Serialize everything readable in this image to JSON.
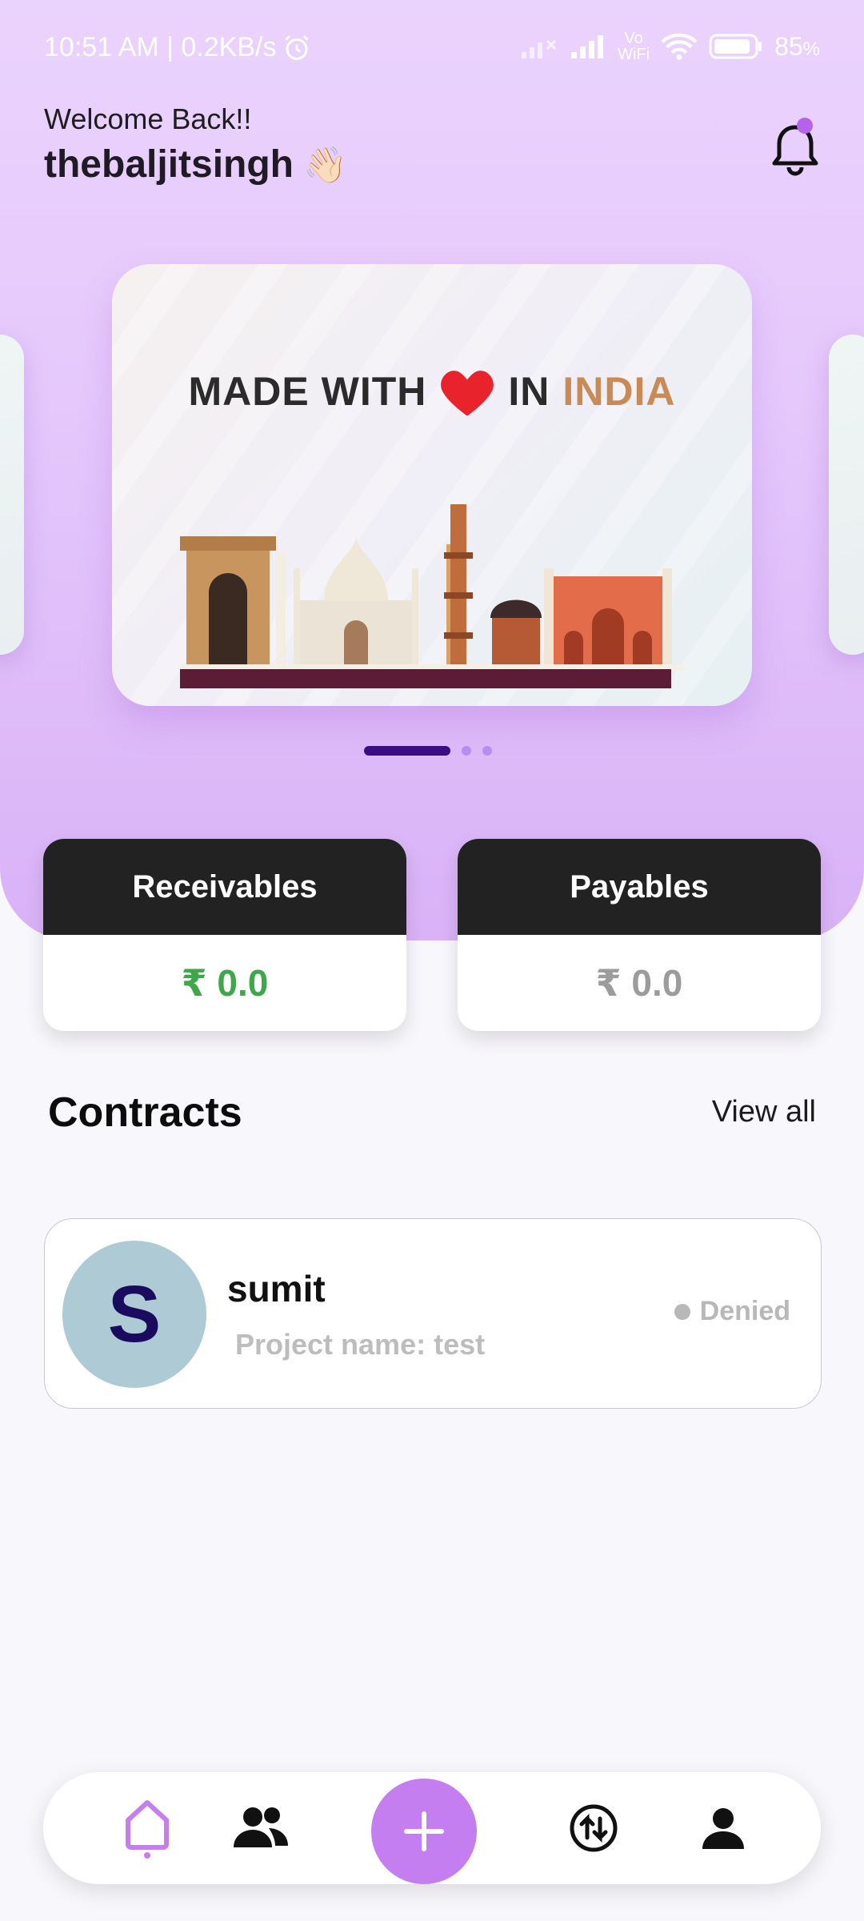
{
  "status_bar": {
    "time_speed": "10:51 AM | 0.2KB/s",
    "network_label": "Vo WiFi",
    "battery": "85"
  },
  "header": {
    "welcome": "Welcome Back!!",
    "username": "thebaljitsingh",
    "wave_emoji": "👋🏻"
  },
  "banner": {
    "title_part1": "MADE WITH",
    "title_part2": "IN",
    "title_part3": "INDIA"
  },
  "carousel": {
    "active_index": 0,
    "count": 3
  },
  "balances": {
    "receivables_label": "Receivables",
    "receivables_value": "₹ 0.0",
    "payables_label": "Payables",
    "payables_value": "₹ 0.0"
  },
  "contracts": {
    "title": "Contracts",
    "view_all": "View all",
    "items": [
      {
        "initial": "S",
        "name": "sumit",
        "project": "Project name: test",
        "status": "Denied"
      }
    ]
  },
  "colors": {
    "accent": "#c57ef0",
    "positive": "#3fa64a",
    "muted": "#9c9c9c",
    "dark_header": "#222222"
  },
  "bottom_nav": {
    "icons": [
      "home-icon",
      "people-icon",
      "add-icon",
      "exchange-icon",
      "profile-icon"
    ],
    "active": "home-icon"
  }
}
